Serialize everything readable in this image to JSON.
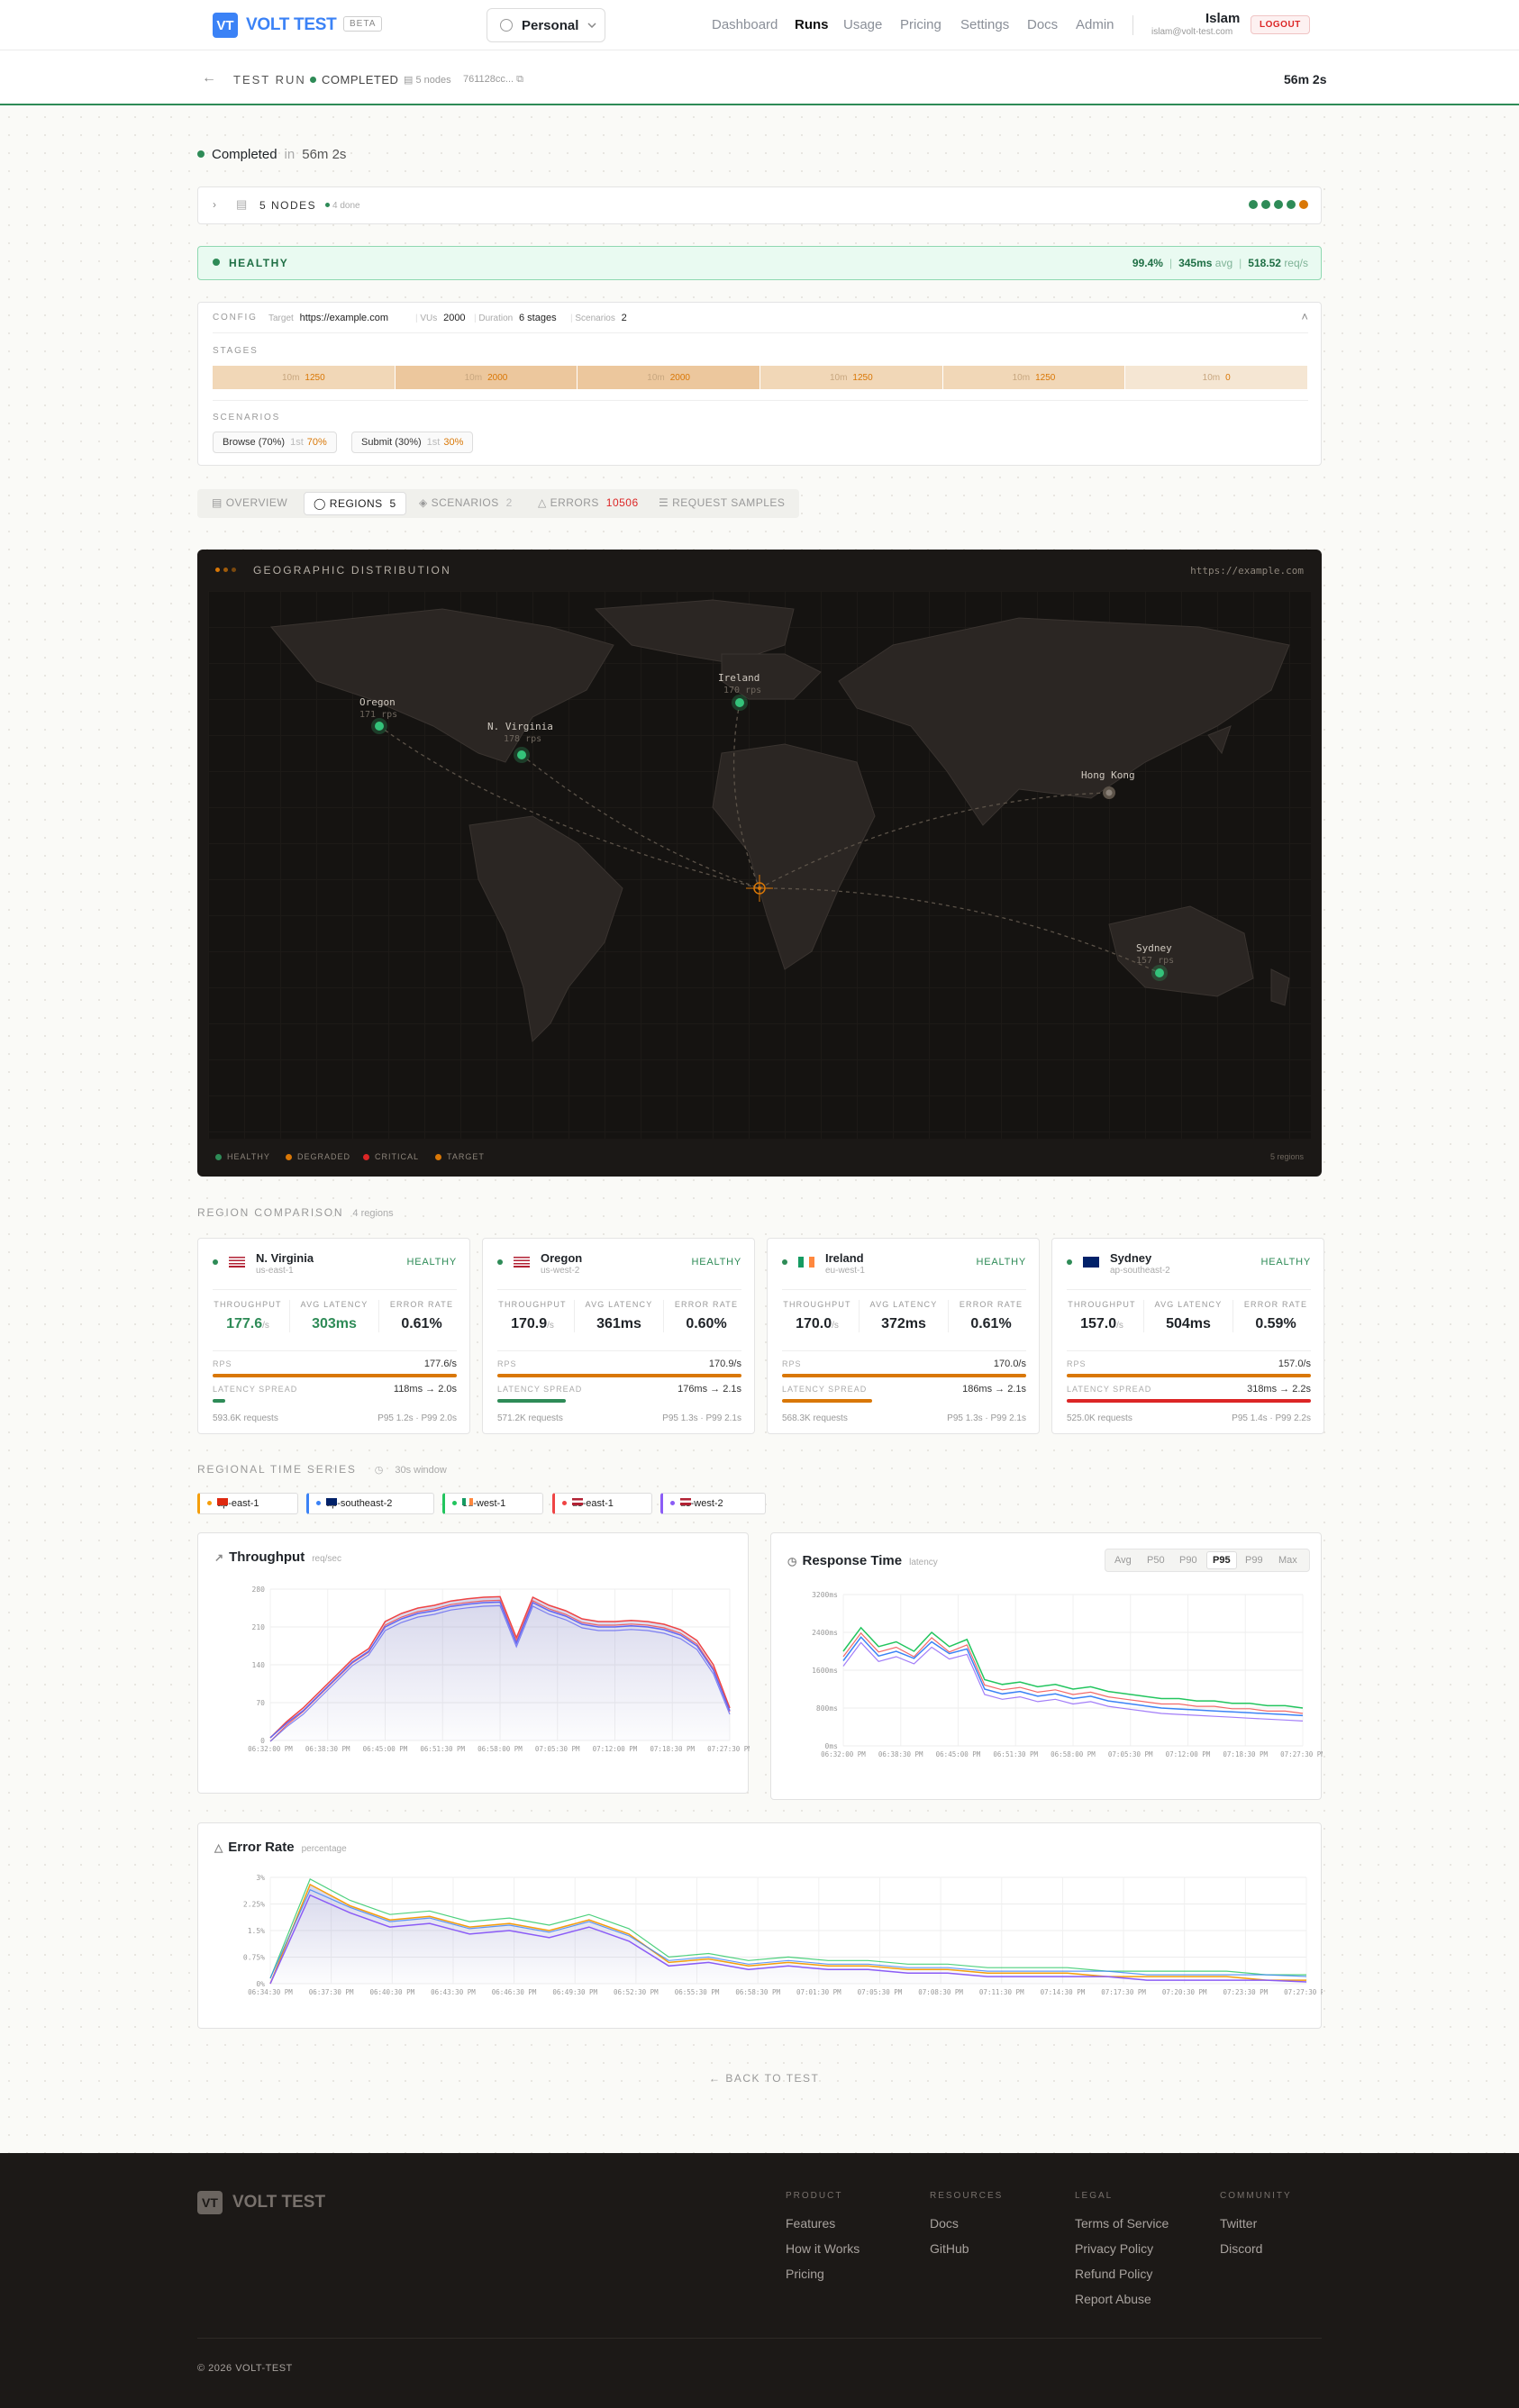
{
  "header": {
    "logo_mark": "VT",
    "logo_text": "VOLT TEST",
    "beta": "BETA",
    "workspace": "Personal",
    "nav": [
      "Dashboard",
      "Runs",
      "Usage",
      "Pricing",
      "Settings",
      "Docs",
      "Admin"
    ],
    "active_nav": "Runs",
    "user_name": "Islam",
    "user_email": "islam@volt-test.com",
    "logout": "LOGOUT"
  },
  "run": {
    "label": "TEST RUN",
    "status": "COMPLETED",
    "nodes": "5 nodes",
    "hash": "761128cc...",
    "duration": "56m 2s"
  },
  "summary": {
    "status": "Completed",
    "in": "in",
    "duration": "56m 2s"
  },
  "nodes": {
    "label": "5 NODES",
    "done": "4 done",
    "colors": [
      "#2e8b57",
      "#2e8b57",
      "#2e8b57",
      "#2e8b57",
      "#d97706"
    ]
  },
  "health": {
    "label": "HEALTHY",
    "success": "99.4%",
    "avg": "345ms",
    "avg_unit": "avg",
    "rps": "518.52",
    "rps_unit": "req/s"
  },
  "config": {
    "label": "CONFIG",
    "target_k": "Target",
    "target": "https://example.com",
    "vus_k": "VUs",
    "vus": "2000",
    "duration_k": "Duration",
    "duration": "6 stages",
    "scenarios_k": "Scenarios",
    "scenarios": "2",
    "stages_label": "STAGES",
    "stages": [
      {
        "d": "10m",
        "v": "1250"
      },
      {
        "d": "10m",
        "v": "2000"
      },
      {
        "d": "10m",
        "v": "2000"
      },
      {
        "d": "10m",
        "v": "1250"
      },
      {
        "d": "10m",
        "v": "1250"
      },
      {
        "d": "10m",
        "v": "0"
      }
    ],
    "scenarios_label": "SCENARIOS",
    "scenario_list": [
      {
        "name": "Browse (70%)",
        "rank": "1st",
        "pct": "70%"
      },
      {
        "name": "Submit (30%)",
        "rank": "1st",
        "pct": "30%"
      }
    ]
  },
  "tabs": [
    {
      "label": "OVERVIEW",
      "count": ""
    },
    {
      "label": "REGIONS",
      "count": "5"
    },
    {
      "label": "SCENARIOS",
      "count": "2"
    },
    {
      "label": "ERRORS",
      "count": "10506"
    },
    {
      "label": "REQUEST SAMPLES",
      "count": ""
    }
  ],
  "map": {
    "title": "GEOGRAPHIC DISTRIBUTION",
    "url": "https://example.com",
    "regions_count": "5 regions",
    "legend": [
      "HEALTHY",
      "DEGRADED",
      "CRITICAL",
      "TARGET"
    ],
    "pins": [
      {
        "name": "Oregon",
        "rps": "171 rps"
      },
      {
        "name": "N. Virginia",
        "rps": "178 rps"
      },
      {
        "name": "Ireland",
        "rps": "170 rps"
      },
      {
        "name": "Hong Kong",
        "rps": ""
      },
      {
        "name": "Sydney",
        "rps": "157 rps"
      }
    ]
  },
  "comparison": {
    "title": "REGION COMPARISON",
    "count": "4 regions",
    "healthy": "HEALTHY",
    "k_tp": "THROUGHPUT",
    "k_lat": "AVG LATENCY",
    "k_err": "ERROR RATE",
    "k_rps": "RPS",
    "k_spread": "LATENCY SPREAD",
    "regions": [
      {
        "name": "N. Virginia",
        "code": "us-east-1",
        "tp": "177.6",
        "unit": "/s",
        "lat": "303ms",
        "err": "0.61%",
        "rps": "177.6/s",
        "spread": "118ms → 2.0s",
        "req": "593.6K requests",
        "pct": "P95 1.2s · P99 2.0s",
        "spread_frac": 0.05
      },
      {
        "name": "Oregon",
        "code": "us-west-2",
        "tp": "170.9",
        "unit": "/s",
        "lat": "361ms",
        "err": "0.60%",
        "rps": "170.9/s",
        "spread": "176ms → 2.1s",
        "req": "571.2K requests",
        "pct": "P95 1.3s · P99 2.1s",
        "spread_frac": 0.28
      },
      {
        "name": "Ireland",
        "code": "eu-west-1",
        "tp": "170.0",
        "unit": "/s",
        "lat": "372ms",
        "err": "0.61%",
        "rps": "170.0/s",
        "spread": "186ms → 2.1s",
        "req": "568.3K requests",
        "pct": "P95 1.3s · P99 2.1s",
        "spread_frac": 0.37
      },
      {
        "name": "Sydney",
        "code": "ap-southeast-2",
        "tp": "157.0",
        "unit": "/s",
        "lat": "504ms",
        "err": "0.59%",
        "rps": "157.0/s",
        "spread": "318ms → 2.2s",
        "req": "525.0K requests",
        "pct": "P95 1.4s · P99 2.2s",
        "spread_frac": 1.0
      }
    ]
  },
  "timeseries": {
    "title": "REGIONAL TIME SERIES",
    "window": "30s window",
    "chips": [
      {
        "name": "ap-east-1",
        "color": "#f59e0b"
      },
      {
        "name": "ap-southeast-2",
        "color": "#3b82f6"
      },
      {
        "name": "eu-west-1",
        "color": "#22c55e"
      },
      {
        "name": "us-east-1",
        "color": "#ef4444"
      },
      {
        "name": "us-west-2",
        "color": "#8b5cf6"
      }
    ]
  },
  "chart_data": [
    {
      "type": "line",
      "title": "Throughput",
      "subtitle": "req/sec",
      "ylim": [
        0,
        280
      ],
      "yticks": [
        "0",
        "70",
        "140",
        "210",
        "280"
      ],
      "xticks": [
        "06:32:00 PM",
        "06:38:30 PM",
        "06:45:00 PM",
        "06:51:30 PM",
        "06:58:00 PM",
        "07:05:30 PM",
        "07:12:00 PM",
        "07:18:30 PM",
        "07:27:30 PM"
      ],
      "series": [
        {
          "values": [
            5,
            35,
            60,
            90,
            120,
            150,
            170,
            220,
            235,
            245,
            250,
            258,
            262,
            265,
            266,
            190,
            265,
            250,
            240,
            225,
            220,
            220,
            222,
            220,
            215,
            205,
            185,
            140,
            60
          ]
        },
        {
          "values": [
            5,
            32,
            55,
            85,
            115,
            145,
            165,
            210,
            225,
            235,
            240,
            248,
            252,
            255,
            256,
            180,
            255,
            240,
            230,
            215,
            210,
            210,
            212,
            210,
            205,
            195,
            175,
            130,
            55
          ]
        }
      ]
    },
    {
      "type": "line",
      "title": "Response Time",
      "subtitle": "latency",
      "options": [
        "Avg",
        "P50",
        "P90",
        "P95",
        "P99",
        "Max"
      ],
      "selected": "P95",
      "ylim": [
        0,
        3200
      ],
      "yticks": [
        "0ms",
        "800ms",
        "1600ms",
        "2400ms",
        "3200ms"
      ],
      "xticks": [
        "06:32:00 PM",
        "06:38:30 PM",
        "06:45:00 PM",
        "06:51:30 PM",
        "06:58:00 PM",
        "07:05:30 PM",
        "07:12:00 PM",
        "07:18:30 PM",
        "07:27:30 PM"
      ],
      "series": [
        {
          "values": [
            2000,
            2500,
            2100,
            2200,
            2000,
            2400,
            2100,
            2250,
            1400,
            1300,
            1350,
            1250,
            1300,
            1200,
            1250,
            1150,
            1100,
            1050,
            1000,
            1000,
            950,
            950,
            900,
            900,
            850,
            850,
            800
          ]
        },
        {
          "values": [
            1800,
            2300,
            1900,
            2000,
            1850,
            2200,
            1950,
            2050,
            1200,
            1100,
            1150,
            1050,
            1100,
            1000,
            1050,
            950,
            900,
            850,
            800,
            780,
            760,
            740,
            720,
            700,
            680,
            660,
            640
          ]
        }
      ]
    },
    {
      "type": "line",
      "title": "Error Rate",
      "subtitle": "percentage",
      "ylim": [
        0,
        3
      ],
      "yticks": [
        "0%",
        "0.75%",
        "1.5%",
        "2.25%",
        "3%"
      ],
      "xticks": [
        "06:34:30 PM",
        "06:37:30 PM",
        "06:40:30 PM",
        "06:43:30 PM",
        "06:46:30 PM",
        "06:49:30 PM",
        "06:52:30 PM",
        "06:55:30 PM",
        "06:58:30 PM",
        "07:01:30 PM",
        "07:05:30 PM",
        "07:08:30 PM",
        "07:11:30 PM",
        "07:14:30 PM",
        "07:17:30 PM",
        "07:20:30 PM",
        "07:23:30 PM",
        "07:27:30 PM"
      ],
      "series": [
        {
          "values": [
            0,
            2.8,
            2.2,
            1.8,
            1.9,
            1.6,
            1.7,
            1.5,
            1.8,
            1.4,
            0.6,
            0.7,
            0.5,
            0.6,
            0.5,
            0.5,
            0.4,
            0.4,
            0.3,
            0.3,
            0.3,
            0.2,
            0.2,
            0.2,
            0.2,
            0.1,
            0.1
          ]
        },
        {
          "values": [
            0,
            2.5,
            2.0,
            1.6,
            1.7,
            1.4,
            1.5,
            1.3,
            1.6,
            1.2,
            0.5,
            0.6,
            0.4,
            0.5,
            0.4,
            0.4,
            0.3,
            0.3,
            0.2,
            0.2,
            0.2,
            0.2,
            0.1,
            0.1,
            0.1,
            0.1,
            0.05
          ]
        }
      ]
    }
  ],
  "back": "BACK TO TEST",
  "footer": {
    "logo_mark": "VT",
    "logo_text": "VOLT TEST",
    "cols": [
      {
        "h": "PRODUCT",
        "links": [
          "Features",
          "How it Works",
          "Pricing"
        ]
      },
      {
        "h": "RESOURCES",
        "links": [
          "Docs",
          "GitHub"
        ]
      },
      {
        "h": "LEGAL",
        "links": [
          "Terms of Service",
          "Privacy Policy",
          "Refund Policy",
          "Report Abuse"
        ]
      },
      {
        "h": "COMMUNITY",
        "links": [
          "Twitter",
          "Discord"
        ]
      }
    ],
    "copyright": "© 2026 VOLT-TEST"
  }
}
